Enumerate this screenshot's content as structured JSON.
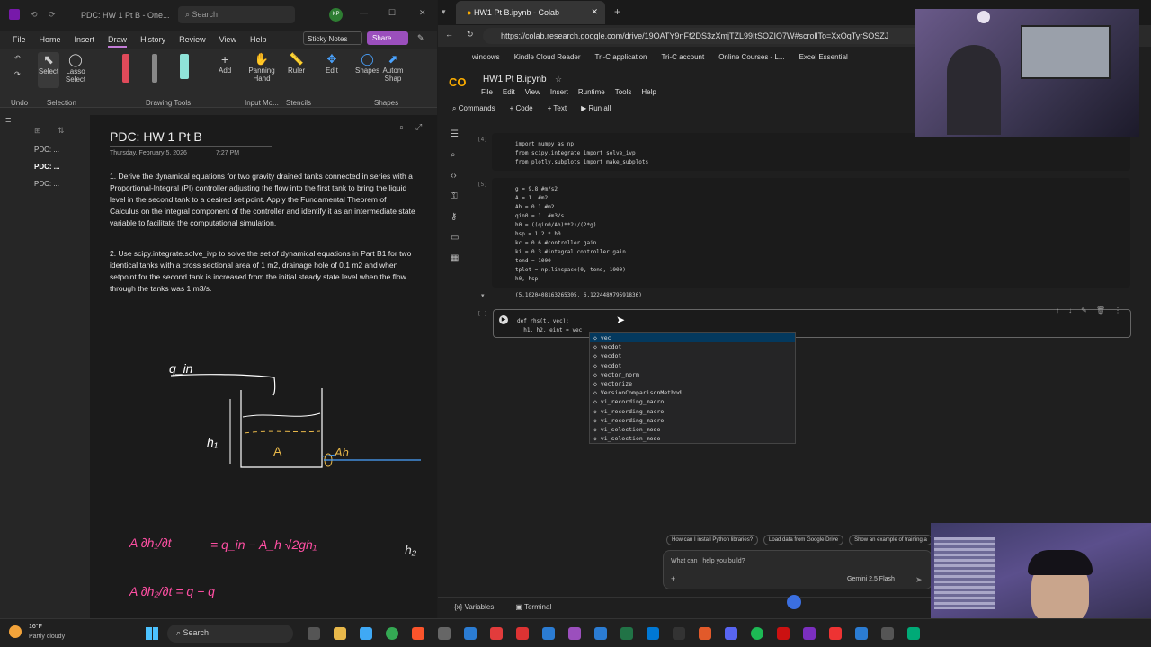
{
  "onenote": {
    "title": "PDC: HW 1 Pt B - One...",
    "search_placeholder": "Search",
    "user_initials": "KP",
    "tabs": [
      "File",
      "Home",
      "Insert",
      "Draw",
      "History",
      "Review",
      "View",
      "Help"
    ],
    "active_tab": "Draw",
    "sticky_notes": "Sticky Notes",
    "share": "Share",
    "tools": {
      "select": "Select",
      "lasso": "Lasso Select",
      "add": "Add",
      "panning": "Panning Hand",
      "ruler": "Ruler",
      "edit": "Edit",
      "shapes": "Shapes",
      "autom": "Autom Shap"
    },
    "groups": {
      "undo": "Undo",
      "selection": "Selection",
      "drawing_tools": "Drawing Tools",
      "input": "Input Mo...",
      "stencils": "Stencils",
      "shapes": "Shapes"
    },
    "pages": [
      "PDC: ...",
      "PDC: ...",
      "PDC: ..."
    ],
    "page_title": "PDC: HW 1 Pt B",
    "page_date": "Thursday, February 5, 2026",
    "page_time": "7:27 PM",
    "para1": "1.  Derive the dynamical equations for two gravity drained tanks connected in series with a Proportional-Integral (PI) controller adjusting the flow into the first tank to bring the liquid level in the second tank to a desired set point.  Apply the Fundamental Theorem of Calculus on the integral component of the controller and identify it as an intermediate state variable to facilitate the computational simulation.",
    "para2": "2.  Use scipy.integrate.solve_ivp to solve the set of dynamical equations in Part B1 for two identical tanks with a cross sectional area of 1 m2, drainage hole of 0.1 m2 and when setpoint for the second tank is increased from the initial steady state level when the flow through the tanks was 1 m3/s.",
    "ink": {
      "q_in": "q_in",
      "h1": "h₁",
      "A": "A",
      "Ah": "Ah",
      "eq1_lhs": "A ∂h₁/∂t",
      "eq1_rhs": "= q_in − A_h √2gh₁",
      "eq2": "A ∂h₂/∂t = q − q",
      "h2": "h₂"
    }
  },
  "chrome": {
    "tab_title": "HW1 Pt B.ipynb - Colab",
    "url": "https://colab.research.google.com/drive/19OATY9nFf2DS3zXmjTZL99ItSOZIO7W#scrollTo=XxOqTyrSOSZJ",
    "bookmarks": [
      "windows",
      "Kindle Cloud Reader",
      "Tri-C application",
      "Tri-C account",
      "Online Courses - L...",
      "Excel Essential"
    ]
  },
  "colab": {
    "logo": "CO",
    "filename": "HW1 Pt B.ipynb",
    "menu": [
      "File",
      "Edit",
      "View",
      "Insert",
      "Runtime",
      "Tools",
      "Help"
    ],
    "toolbar": {
      "commands": "Commands",
      "code": "+ Code",
      "text": "+ Text",
      "run_all": "Run all"
    },
    "cell1_exec": "[4]",
    "cell1_code": "import numpy as np\nfrom scipy.integrate import solve_ivp\nfrom plotly.subplots import make_subplots",
    "cell2_exec": "[5]",
    "cell2_code": "g = 9.8 #m/s2\nA = 1. #m2\nAh = 0.1 #m2\nqin0 = 1. #m3/s\nh0 = ((qin0/Ah)**2)/(2*g)\nhsp = 1.2 * h0\nkc = 0.6 #controller gain\nki = 0.3 #integral controller gain\ntend = 1000\ntplot = np.linspace(0, tend, 1000)\nh0, hsp",
    "cell2_output": "(5.1020408163265305, 6.122448979591836)",
    "cell3_exec": "[ ]",
    "cell3_code": "def rhs(t, vec):\n  h1, h2, eint = vec",
    "autocomplete": [
      "vec",
      "vecdot",
      "vecdot",
      "vecdot",
      "vector_norm",
      "vectorize",
      "VersionComparisonMethod",
      "vi_recording_macro",
      "vi_recording_macro",
      "vi_recording_macro",
      "vi_selection_mode",
      "vi_selection_mode"
    ],
    "suggestions": [
      "How can I install Python libraries?",
      "Load data from Google Drive",
      "Show an example of training a"
    ],
    "gemini_placeholder": "What can I help you build?",
    "gemini_model": "Gemini 2.5 Flash",
    "bottom": {
      "variables": "Variables",
      "terminal": "Terminal"
    }
  },
  "taskbar": {
    "weather_temp": "16°F",
    "weather_desc": "Partly cloudy",
    "search": "Search"
  }
}
